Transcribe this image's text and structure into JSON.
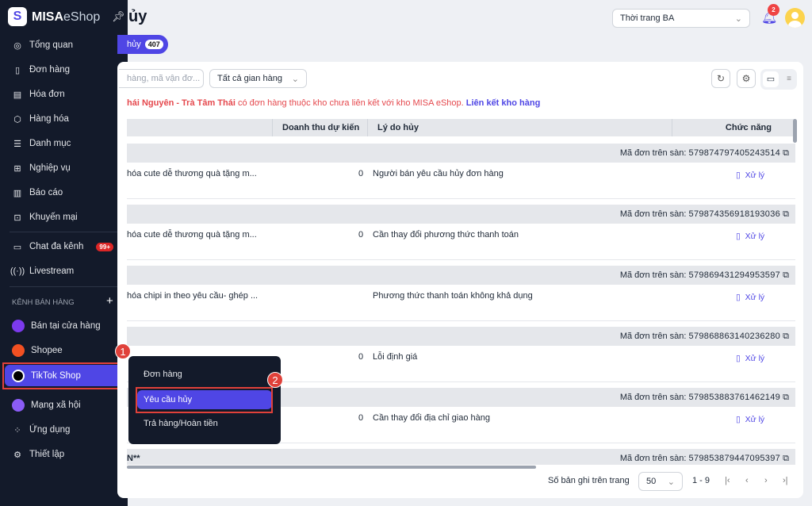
{
  "app": {
    "brand_bold": "MISA",
    "brand_light": "eShop",
    "logo_letter": "S"
  },
  "sidebar": {
    "items": [
      {
        "label": "Tổng quan",
        "icon": "dashboard-icon"
      },
      {
        "label": "Đơn hàng",
        "icon": "order-icon"
      },
      {
        "label": "Hóa đơn",
        "icon": "invoice-icon"
      },
      {
        "label": "Hàng hóa",
        "icon": "box-icon"
      },
      {
        "label": "Danh mục",
        "icon": "list-icon"
      },
      {
        "label": "Nghiệp vụ",
        "icon": "operations-icon"
      },
      {
        "label": "Báo cáo",
        "icon": "report-icon"
      },
      {
        "label": "Khuyến mại",
        "icon": "gift-icon"
      }
    ],
    "chat": {
      "label": "Chat đa kênh",
      "badge": "99+"
    },
    "livestream": "Livestream",
    "channels_header": "KÊNH BÁN HÀNG",
    "channels": [
      {
        "label": "Bán tại cửa hàng",
        "color": "#7c3aed"
      },
      {
        "label": "Shopee",
        "color": "#f25022"
      },
      {
        "label": "TikTok Shop",
        "color": "#000000"
      },
      {
        "label": "Mạng xã hội",
        "color": "#7c3aed"
      }
    ],
    "bottom": [
      {
        "label": "Ứng dụng"
      },
      {
        "label": "Thiết lập"
      }
    ]
  },
  "annotations": {
    "step1": "1",
    "step2": "2"
  },
  "popup": {
    "items": [
      "Đơn hàng",
      "Yêu cầu hủy",
      "Trả hàng/Hoàn tiền"
    ]
  },
  "header": {
    "title": "ủy",
    "shop": "Thời trang BA",
    "notif_count": "2"
  },
  "tab": {
    "label": "hủy",
    "count": "407"
  },
  "toolbar": {
    "search_placeholder": "hàng, mã vận đơ...",
    "store_filter": "Tất cả gian hàng"
  },
  "warning": {
    "bold": "hái Nguyên - Trà Tâm Thái",
    "text": " có đơn hàng thuộc kho chưa liên kết với kho MISA eShop. ",
    "link": "Liên kết kho hàng"
  },
  "table": {
    "columns": [
      "Doanh thu dự kiến",
      "Lý do hủy",
      "Chức năng"
    ],
    "code_label": "Mã đơn trên sàn:",
    "action": "Xử lý",
    "rows": [
      {
        "code": "579874797405243514",
        "product": "hóa cute dễ thương quà tặng m...",
        "revenue": "0",
        "reason": "Người bán yêu cầu hủy đơn hàng"
      },
      {
        "code": "579874356918193036",
        "product": "hóa cute dễ thương quà tặng m...",
        "revenue": "0",
        "reason": "Cần thay đổi phương thức thanh toán"
      },
      {
        "code": "579869431294953597",
        "product": "hóa chipi in theo yêu cầu- ghép ...",
        "revenue": "",
        "reason": "Phương thức thanh toán không khả dụng"
      },
      {
        "code": "579868863140236280",
        "product": "",
        "revenue": "0",
        "reason": "Lỗi định giá"
      },
      {
        "code": "579853883761462149",
        "product": "",
        "revenue": "0",
        "reason": "Cần thay đổi địa chỉ giao hàng"
      }
    ],
    "last_group": {
      "name": "N**",
      "code": "579853879447095397"
    }
  },
  "pagination": {
    "label": "Số bản ghi trên trang",
    "page_size": "50",
    "range": "1 - 9"
  }
}
